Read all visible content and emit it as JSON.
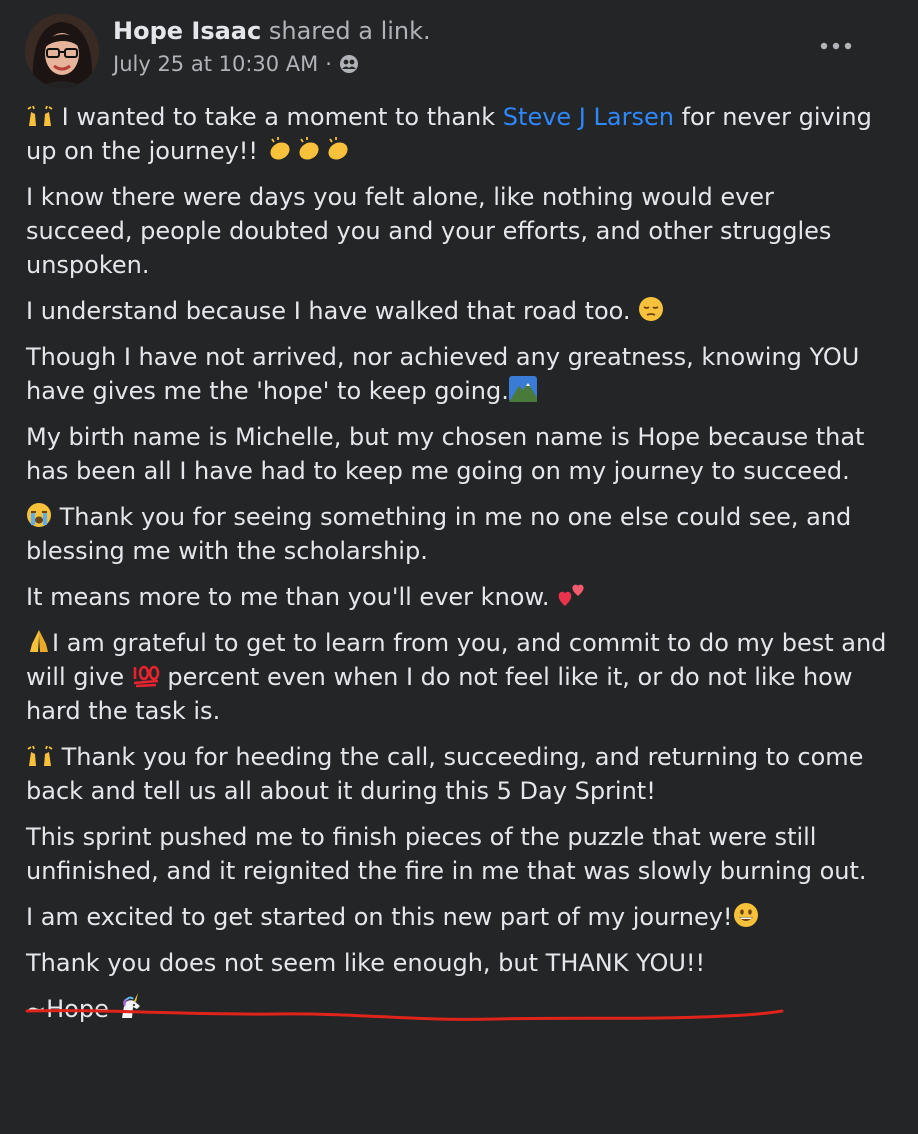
{
  "post": {
    "author_name": "Hope Isaac",
    "action": "shared a link.",
    "timestamp": "July 25 at 10:30 AM",
    "separator": "·",
    "audience_icon": "friends-icon",
    "more_icon": "more-options-icon"
  },
  "body": {
    "p1": {
      "before_mention": "I wanted to take a moment to thank ",
      "mention": "Steve J Larsen",
      "after_mention": " for never giving up on the journey!! "
    },
    "p2": "I know there were days you felt alone, like nothing would ever succeed, people doubted you and your efforts, and other struggles unspoken.",
    "p3": "I understand because I have walked that road too. ",
    "p4": "Though I have not arrived, nor achieved any greatness, knowing YOU have gives me the 'hope' to keep going.",
    "p5": "My birth name is Michelle, but my chosen name is Hope because that has been all I have had to keep me going on my journey to succeed.",
    "p6": " Thank you for seeing something in me no one else could see, and blessing me with the scholarship.",
    "p7": "It means more to me than you'll ever know. ",
    "p8": {
      "before": "I am grateful to get to learn from you, and commit to do my best and will give ",
      "after": " percent even when I do not feel like it, or do not like how hard the task is."
    },
    "p9": " Thank you for heeding the call, succeeding, and returning to come back and tell us all about it during this 5 Day Sprint!",
    "p10": "This sprint pushed me to finish pieces of the puzzle that were still unfinished, and it reignited the fire in me that was slowly burning out.",
    "p11": "I am excited to get started on this new part of my journey!",
    "p12": "Thank you does not seem like enough, but THANK YOU!!",
    "p13": "~Hope "
  },
  "colors": {
    "background": "#242526",
    "text": "#e4e6eb",
    "secondary_text": "#b0b3b8",
    "link": "#2d88ff",
    "annotation_underline": "#e0241b"
  },
  "emojis": {
    "raising_hands": "raising-hands-emoji",
    "clapping_hands": "clapping-hands-emoji",
    "pensive_face": "pensive-face-emoji",
    "mountain": "mountain-emoji",
    "crying_face": "loudly-crying-face-emoji",
    "two_hearts": "two-hearts-emoji",
    "folded_hands": "folded-hands-emoji",
    "hundred_points": "hundred-points-emoji",
    "grinning_face": "grinning-face-emoji",
    "unicorn": "unicorn-emoji"
  }
}
